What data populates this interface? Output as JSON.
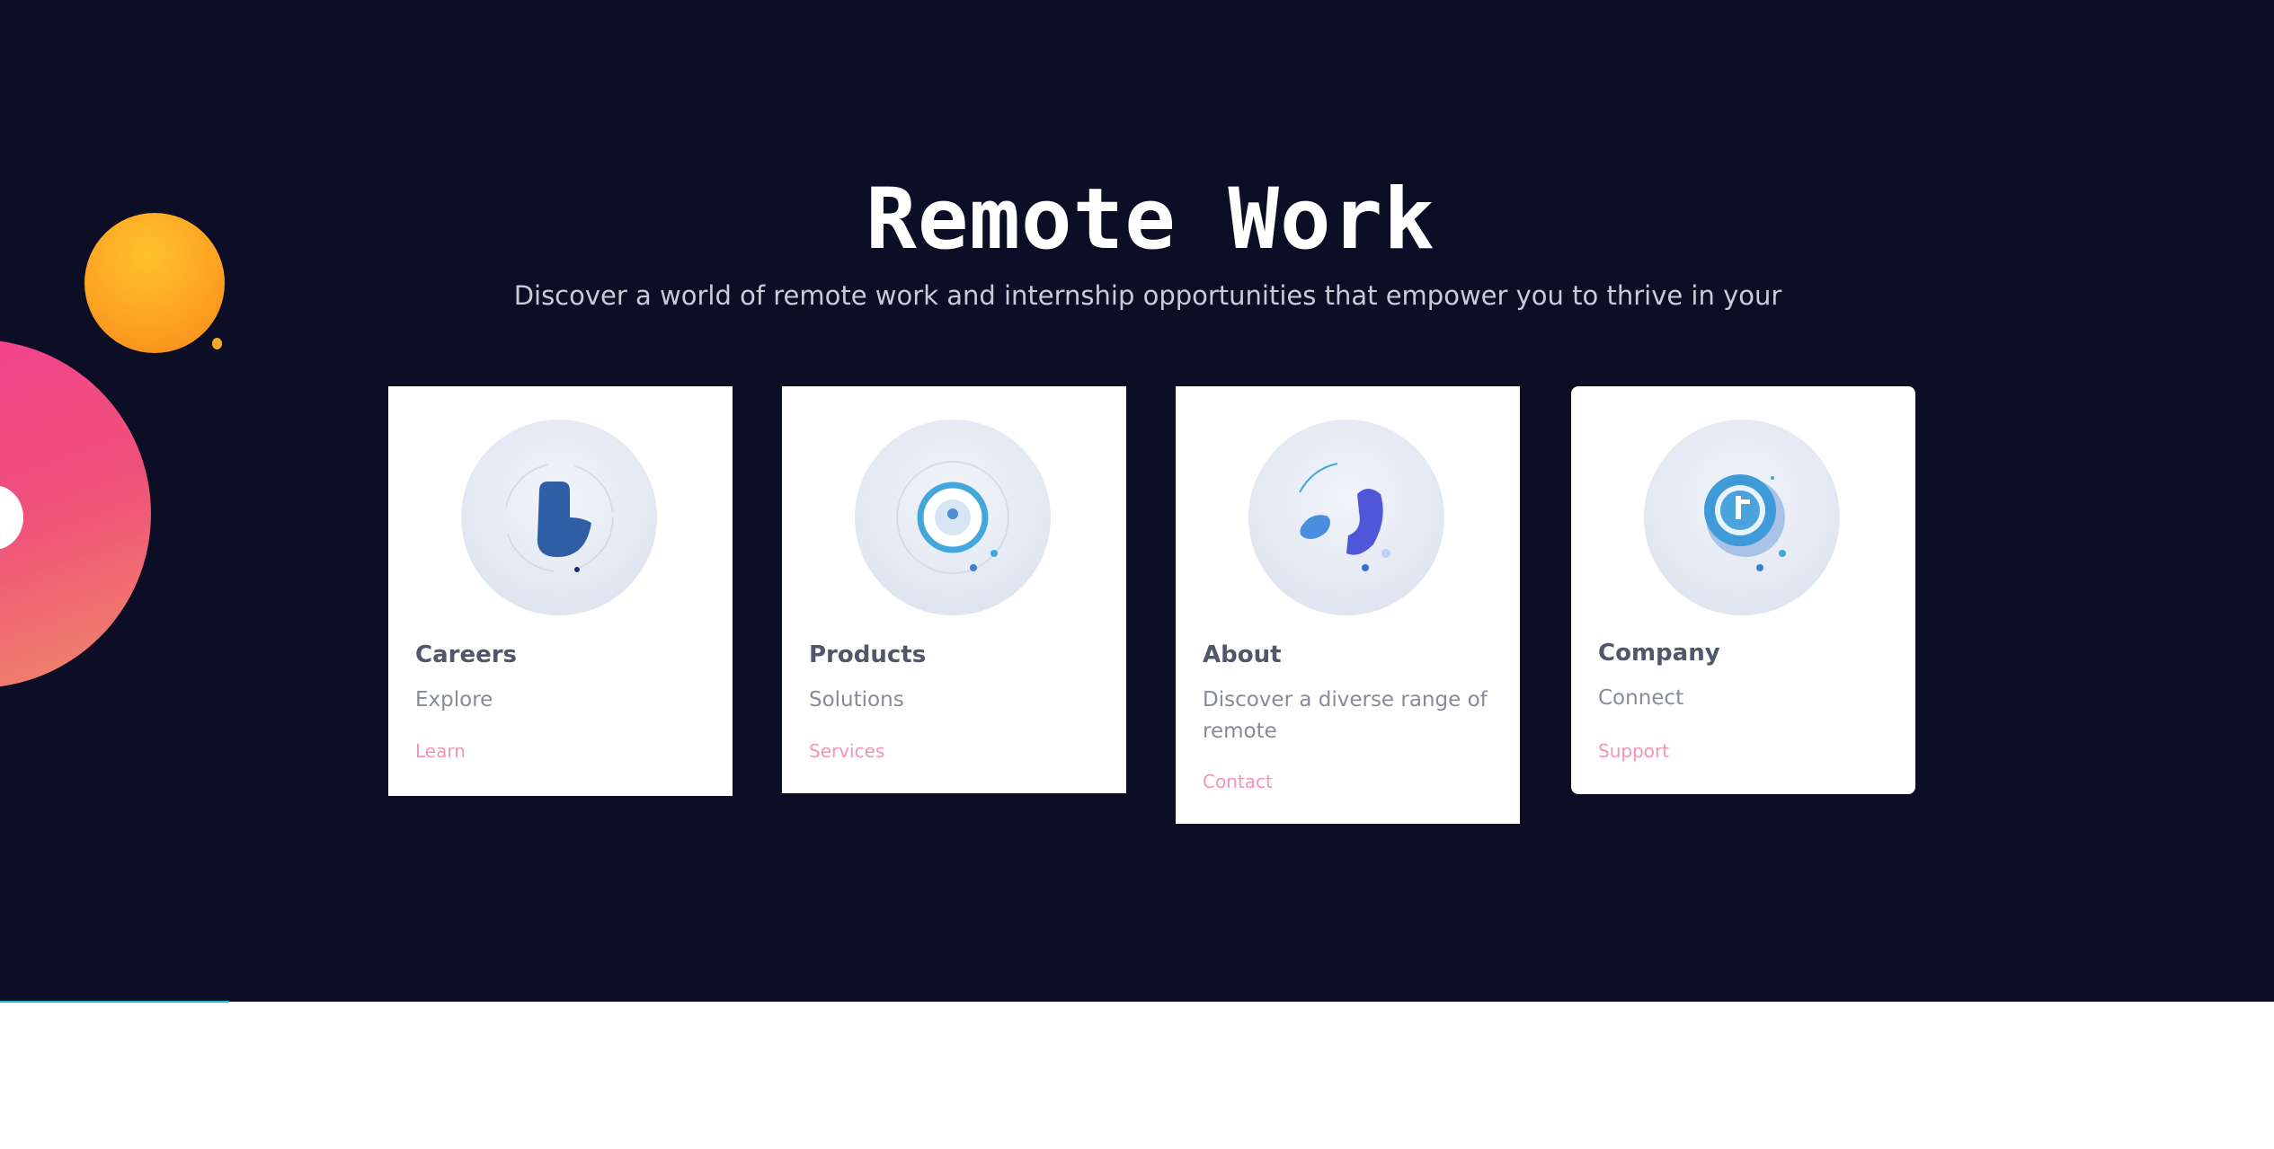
{
  "hero": {
    "title": "Remote Work",
    "subtitle": "Discover a world of remote work and internship opportunities that empower you to thrive in your"
  },
  "cards": [
    {
      "title": "Careers",
      "description": "Explore",
      "link": "Learn",
      "icon": "pin-icon"
    },
    {
      "title": "Products",
      "description": "Solutions",
      "link": "Services",
      "icon": "target-icon"
    },
    {
      "title": "About",
      "description": "Discover a diverse range of remote",
      "link": "Contact",
      "icon": "swirl-icon"
    },
    {
      "title": "Company",
      "description": "Connect",
      "link": "Support",
      "icon": "clock-icon"
    }
  ],
  "colors": {
    "background": "#0c0e26",
    "card": "#ffffff",
    "link": "#f294b8",
    "orange_accent": "#fda322",
    "pink_accent": "#f0527a"
  }
}
